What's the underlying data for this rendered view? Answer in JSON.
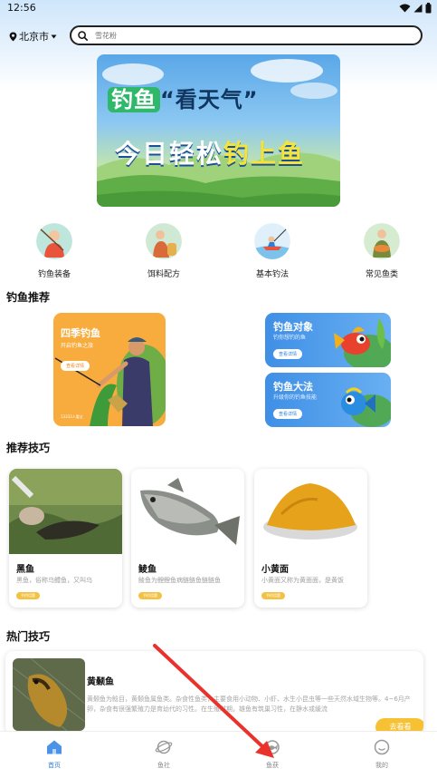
{
  "status_bar": {
    "time": "12:56"
  },
  "location": {
    "city": "北京市"
  },
  "search": {
    "placeholder": "雪花粉"
  },
  "banner": {
    "line1_green": "钓鱼",
    "line1_quote": "“看天气”",
    "line2_white": "今日轻松",
    "line2_yellow": "钓上鱼"
  },
  "categories": [
    {
      "label": "钓鱼装备",
      "icon": "fishing-gear-icon"
    },
    {
      "label": "饵料配方",
      "icon": "bait-recipe-icon"
    },
    {
      "label": "基本钓法",
      "icon": "basic-method-icon"
    },
    {
      "label": "常见鱼类",
      "icon": "common-fish-icon"
    }
  ],
  "recommend": {
    "title": "钓鱼推荐",
    "big_card": {
      "title": "四季钓鱼",
      "subtitle": "开启钓鱼之旅",
      "button": "查看详情",
      "footer": "13333人看过"
    },
    "small_cards": [
      {
        "title": "钓鱼对象",
        "subtitle": "钓你想钓的鱼",
        "button": "查看详情"
      },
      {
        "title": "钓鱼大法",
        "subtitle": "升级你的钓鱼技能",
        "button": "查看详情"
      }
    ]
  },
  "tips": {
    "title": "推荐技巧",
    "items": [
      {
        "name": "黑鱼",
        "desc": "黑鱼，俗称乌鳢鱼，又叫乌",
        "tag": "节约话题"
      },
      {
        "name": "鲮鱼",
        "desc": "鲮鱼为鲤鲤鱼病鲢鲢鱼鲢鲢鱼",
        "tag": "节约话题"
      },
      {
        "name": "小黄面",
        "desc": "小黄面又称为黄面面，是黄饭",
        "tag": "节约话题"
      }
    ]
  },
  "hot": {
    "title": "热门技巧",
    "item": {
      "name": "黄颡鱼",
      "desc": "黄颡鱼为鲶目，黄颡鱼属鱼类。杂食性鱼类，主要食用小动物、小虾、水生小昆虫等一些天然水域生物等。4~6月产卵，杂食有很强繁殖力是育幼代的习性。在生殖时期，雄鱼有筑巢习性，在静水或缓流",
      "button": "去看看"
    }
  },
  "tabbar": [
    {
      "label": "首页",
      "icon": "home-icon",
      "active": true
    },
    {
      "label": "鱼社",
      "icon": "planet-icon",
      "active": false
    },
    {
      "label": "鱼获",
      "icon": "fish-catch-icon",
      "active": false
    },
    {
      "label": "我的",
      "icon": "profile-icon",
      "active": false
    }
  ],
  "colors": {
    "accent": "#2f7fd8",
    "orange": "#f8ac3d",
    "yellow_button": "#f6c234",
    "arrow": "#e8322b"
  }
}
